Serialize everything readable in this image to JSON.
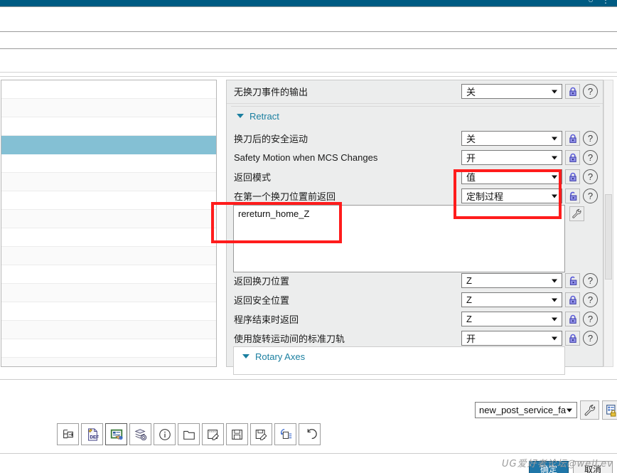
{
  "window": {
    "titlebar_color": "#005b82",
    "titlebar_icons": "○ ⋮"
  },
  "left_panel": {
    "name": "parameter-list",
    "rows": 16,
    "selected_row_index": 3,
    "selected_color": "#84c0d4"
  },
  "properties": {
    "rows": [
      {
        "label": "无换刀事件的输出",
        "value": "关",
        "lock": "locked",
        "help": "?"
      },
      {
        "label": "换刀后的安全运动",
        "value": "关",
        "lock": "locked",
        "help": "?"
      },
      {
        "label": "Safety Motion when MCS Changes",
        "value": "开",
        "lock": "locked",
        "help": "?"
      },
      {
        "label": "返回模式",
        "value": "值",
        "lock": "locked",
        "help": "?"
      },
      {
        "label": "在第一个换刀位置前返回",
        "value": "定制过程",
        "lock": "unlocked",
        "help": "?"
      },
      {
        "label": "返回换刀位置",
        "value": "Z",
        "lock": "unlocked",
        "help": "?"
      },
      {
        "label": "返回安全位置",
        "value": "Z",
        "lock": "locked",
        "help": "?"
      },
      {
        "label": "程序结束时返回",
        "value": "Z",
        "lock": "locked",
        "help": "?"
      },
      {
        "label": "使用旋转运动间的标准刀轨",
        "value": "开",
        "lock": "locked",
        "help": "?"
      }
    ],
    "section_retract": "Retract",
    "section_rotary_axes": "Rotary Axes",
    "custom_procedure_text": "rereturn_home_Z",
    "wrench_tool": "wrench-icon",
    "section_title_color": "#1a7fa0"
  },
  "annotations": {
    "color": "#ff1c1c",
    "boxes": [
      {
        "name": "highlight-custom-procedure-text"
      },
      {
        "name": "highlight-return-mode-combos"
      }
    ]
  },
  "bottom": {
    "post_combo_value": "new_post_service_fa",
    "wrench_button": "wrench-icon",
    "properties_button": "post-properties-lock-icon",
    "toolbar_items": [
      {
        "name": "export-tree-icon",
        "glyph": "tree-export"
      },
      {
        "name": "def-file-icon",
        "glyph": "DEF"
      },
      {
        "name": "edit-form-icon",
        "glyph": "form-edit"
      },
      {
        "name": "layers-gear-icon",
        "glyph": "layers-gear"
      },
      {
        "name": "info-icon",
        "glyph": "i"
      },
      {
        "name": "open-folder-icon",
        "glyph": "folder"
      },
      {
        "name": "new-document-edit-icon",
        "glyph": "doc-edit"
      },
      {
        "name": "save-icon",
        "glyph": "floppy"
      },
      {
        "name": "save-as-icon",
        "glyph": "floppy-edit"
      },
      {
        "name": "copy-list-icon",
        "glyph": "copy-list"
      },
      {
        "name": "undo-icon",
        "glyph": "undo"
      }
    ],
    "ok_label": "确定",
    "cancel_label": "取消",
    "watermark": "UG爱好者论坛@weiLev"
  }
}
